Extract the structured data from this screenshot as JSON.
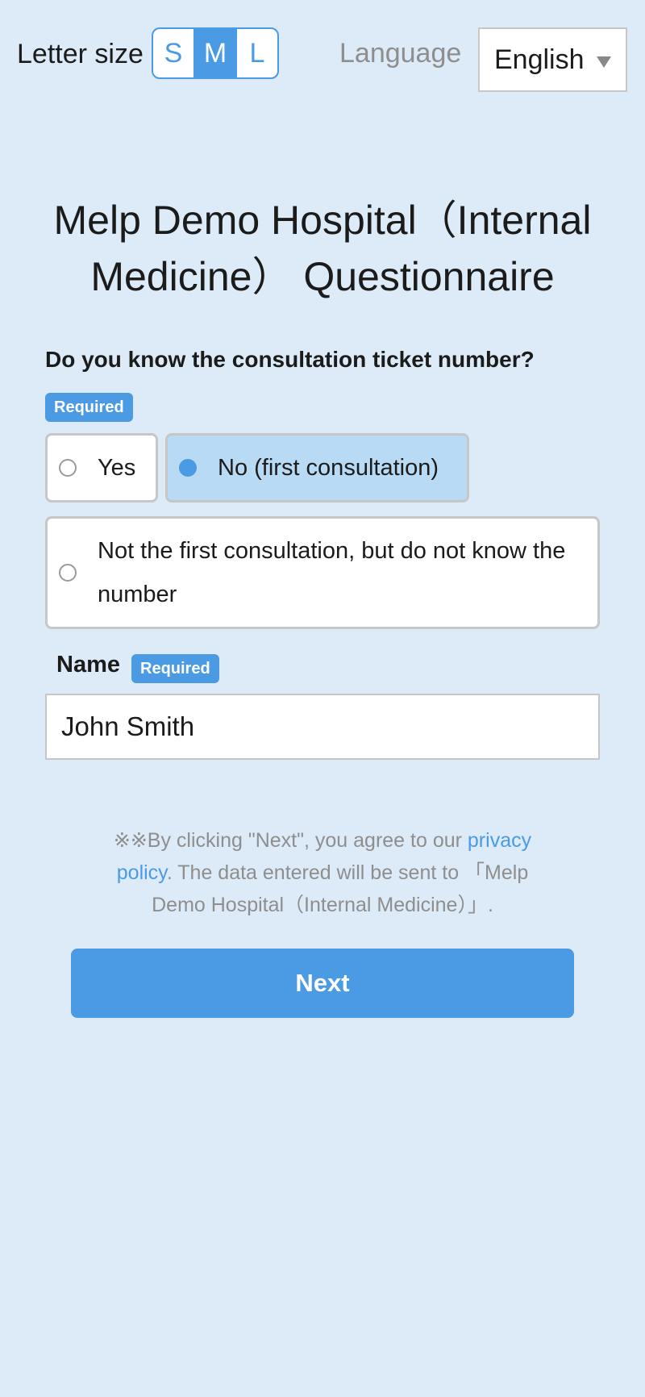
{
  "top_bar": {
    "letter_size_label": "Letter size",
    "sizes": [
      "S",
      "M",
      "L"
    ],
    "active_size": "M",
    "language_label": "Language",
    "language_value": "English"
  },
  "title": {
    "line1": "Melp Demo Hospital（Internal",
    "line2": "Medicine） Questionnaire"
  },
  "question": {
    "text": "Do you know the consultation ticket number?",
    "required_badge": "Required",
    "options": [
      {
        "label": "Yes",
        "selected": false
      },
      {
        "label": "No (first consultation)",
        "selected": true
      },
      {
        "label": "Not the first consultation, but do not know the number",
        "selected": false
      }
    ]
  },
  "name_field": {
    "label": "Name",
    "required_badge": "Required",
    "value": "John Smith"
  },
  "consent": {
    "prefix": "※※By clicking \"Next\", you agree to our ",
    "link_text": "privacy policy",
    "suffix": ". The data entered will be sent to 「Melp Demo Hospital（Internal Medicine）」."
  },
  "next_button": {
    "label": "Next"
  },
  "colors": {
    "background": "#ddeaf8",
    "accent": "#4a9be3",
    "selected_option": "#b9daf4"
  }
}
